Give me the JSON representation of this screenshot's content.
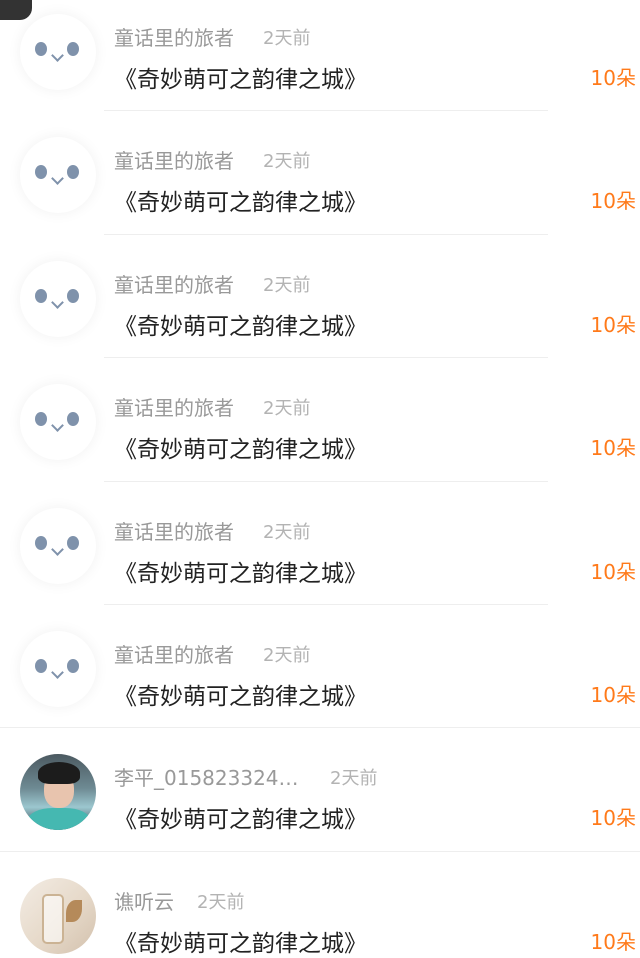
{
  "records": [
    {
      "author": "童话里的旅者",
      "time": "2天前",
      "title": "《奇妙萌可之韵律之城》",
      "gift": "10朵",
      "avatar_icon": "default-avatar-icon"
    },
    {
      "author": "童话里的旅者",
      "time": "2天前",
      "title": "《奇妙萌可之韵律之城》",
      "gift": "10朵",
      "avatar_icon": "default-avatar-icon"
    },
    {
      "author": "童话里的旅者",
      "time": "2天前",
      "title": "《奇妙萌可之韵律之城》",
      "gift": "10朵",
      "avatar_icon": "default-avatar-icon"
    },
    {
      "author": "童话里的旅者",
      "time": "2天前",
      "title": "《奇妙萌可之韵律之城》",
      "gift": "10朵",
      "avatar_icon": "default-avatar-icon"
    },
    {
      "author": "童话里的旅者",
      "time": "2天前",
      "title": "《奇妙萌可之韵律之城》",
      "gift": "10朵",
      "avatar_icon": "default-avatar-icon"
    },
    {
      "author": "童话里的旅者",
      "time": "2天前",
      "title": "《奇妙萌可之韵律之城》",
      "gift": "10朵",
      "avatar_icon": "default-avatar-icon"
    },
    {
      "author": "李平_015823324…",
      "time": "2天前",
      "title": "《奇妙萌可之韵律之城》",
      "gift": "10朵",
      "avatar_icon": "user-photo-avatar"
    },
    {
      "author": "谯听云",
      "time": "2天前",
      "title": "《奇妙萌可之韵律之城》",
      "gift": "10朵",
      "avatar_icon": "user-photo-avatar"
    }
  ],
  "colors": {
    "accent": "#ff7a1a",
    "author_text": "#999999",
    "time_text": "#b3b3b3",
    "title_text": "#222222",
    "avatar_face": "#7f92ab"
  }
}
